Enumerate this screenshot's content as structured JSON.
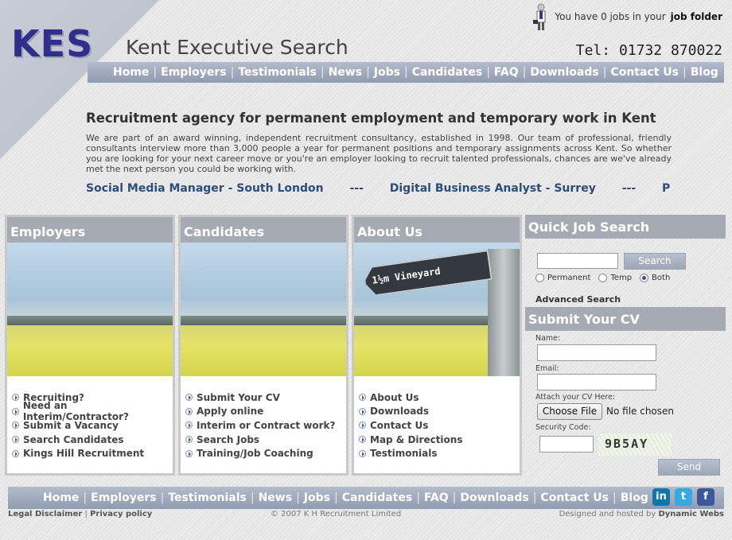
{
  "header": {
    "logo": "KES",
    "site_title": "Kent Executive Search",
    "phone": "Tel: 01732 870022",
    "job_folder_prefix": "You have 0 jobs in your",
    "job_folder_link": "job folder"
  },
  "nav": [
    "Home",
    "Employers",
    "Testimonials",
    "News",
    "Jobs",
    "Candidates",
    "FAQ",
    "Downloads",
    "Contact Us",
    "Blog"
  ],
  "intro": {
    "title": "Recruitment agency for permanent employment and temporary work in Kent",
    "text": "We are part of an award winning, independent recruitment consultancy, established in 1998. Our team of professional, friendly consultants interview more than 3,000 people a year for permanent positions and temporary assignments across Kent. So whether you are looking for your next career move or you're an employer looking to recruit talented professionals, chances are we've already met the next person you could be working with."
  },
  "ticker": [
    "Social Media Manager - South London",
    "---",
    "Digital Business Analyst - Surrey",
    "---",
    "PR Ac"
  ],
  "panels": [
    {
      "title": "Employers",
      "links": [
        "Recruiting?",
        "Need an Interim/Contractor?",
        "Submit a Vacancy",
        "Search Candidates",
        "Kings Hill Recruitment"
      ]
    },
    {
      "title": "Candidates",
      "links": [
        "Submit Your CV",
        "Apply online",
        "Interim or Contract work?",
        "Search Jobs",
        "Training/Job Coaching"
      ]
    },
    {
      "title": "About Us",
      "sign_text": "1½m Vineyard",
      "links": [
        "About Us",
        "Downloads",
        "Contact Us",
        "Map & Directions",
        "Testimonials"
      ]
    }
  ],
  "quick_search": {
    "title": "Quick Job Search",
    "input_value": "",
    "button": "Search",
    "options": [
      "Permanent",
      "Temp",
      "Both"
    ],
    "selected": "Both",
    "advanced": "Advanced Search"
  },
  "cv": {
    "title": "Submit Your CV",
    "name_label": "Name:",
    "email_label": "Email:",
    "attach_label": "Attach your CV Here:",
    "file_button": "Choose File",
    "file_status": "No file chosen",
    "security_label": "Security Code:",
    "captcha": "9B5AY",
    "send_button": "Send"
  },
  "social": {
    "linkedin": "in",
    "twitter": "t",
    "facebook": "f"
  },
  "footer": {
    "legal": "Legal Disclaimer",
    "privacy": "Privacy policy",
    "copyright": "© 2007 K H Recruitment Limited",
    "designed_prefix": "Designed and hosted by",
    "designer": "Dynamic Webs"
  },
  "colors": {
    "nav_bar": "#9ba6b9",
    "panel_header": "#a6aab3",
    "ticker_text": "#2d4d7a",
    "logo": "#2f2f8a"
  }
}
